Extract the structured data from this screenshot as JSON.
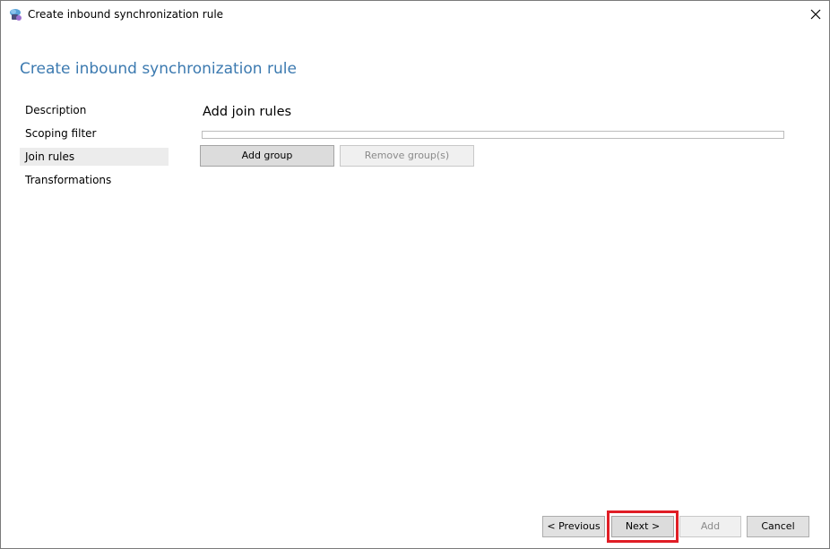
{
  "window": {
    "title": "Create inbound synchronization rule",
    "app_icon": "sync-service-icon",
    "close_icon": "close-icon"
  },
  "page": {
    "heading": "Create inbound synchronization rule"
  },
  "nav": {
    "items": [
      {
        "label": "Description",
        "selected": false
      },
      {
        "label": "Scoping filter",
        "selected": false
      },
      {
        "label": "Join rules",
        "selected": true
      },
      {
        "label": "Transformations",
        "selected": false
      }
    ]
  },
  "main": {
    "section_title": "Add join rules",
    "progress": 0,
    "add_group_label": "Add group",
    "remove_group_label": "Remove group(s)"
  },
  "footer": {
    "previous_label": "< Previous",
    "next_label": "Next >",
    "add_label": "Add",
    "cancel_label": "Cancel",
    "highlight_color": "#e01e26"
  }
}
